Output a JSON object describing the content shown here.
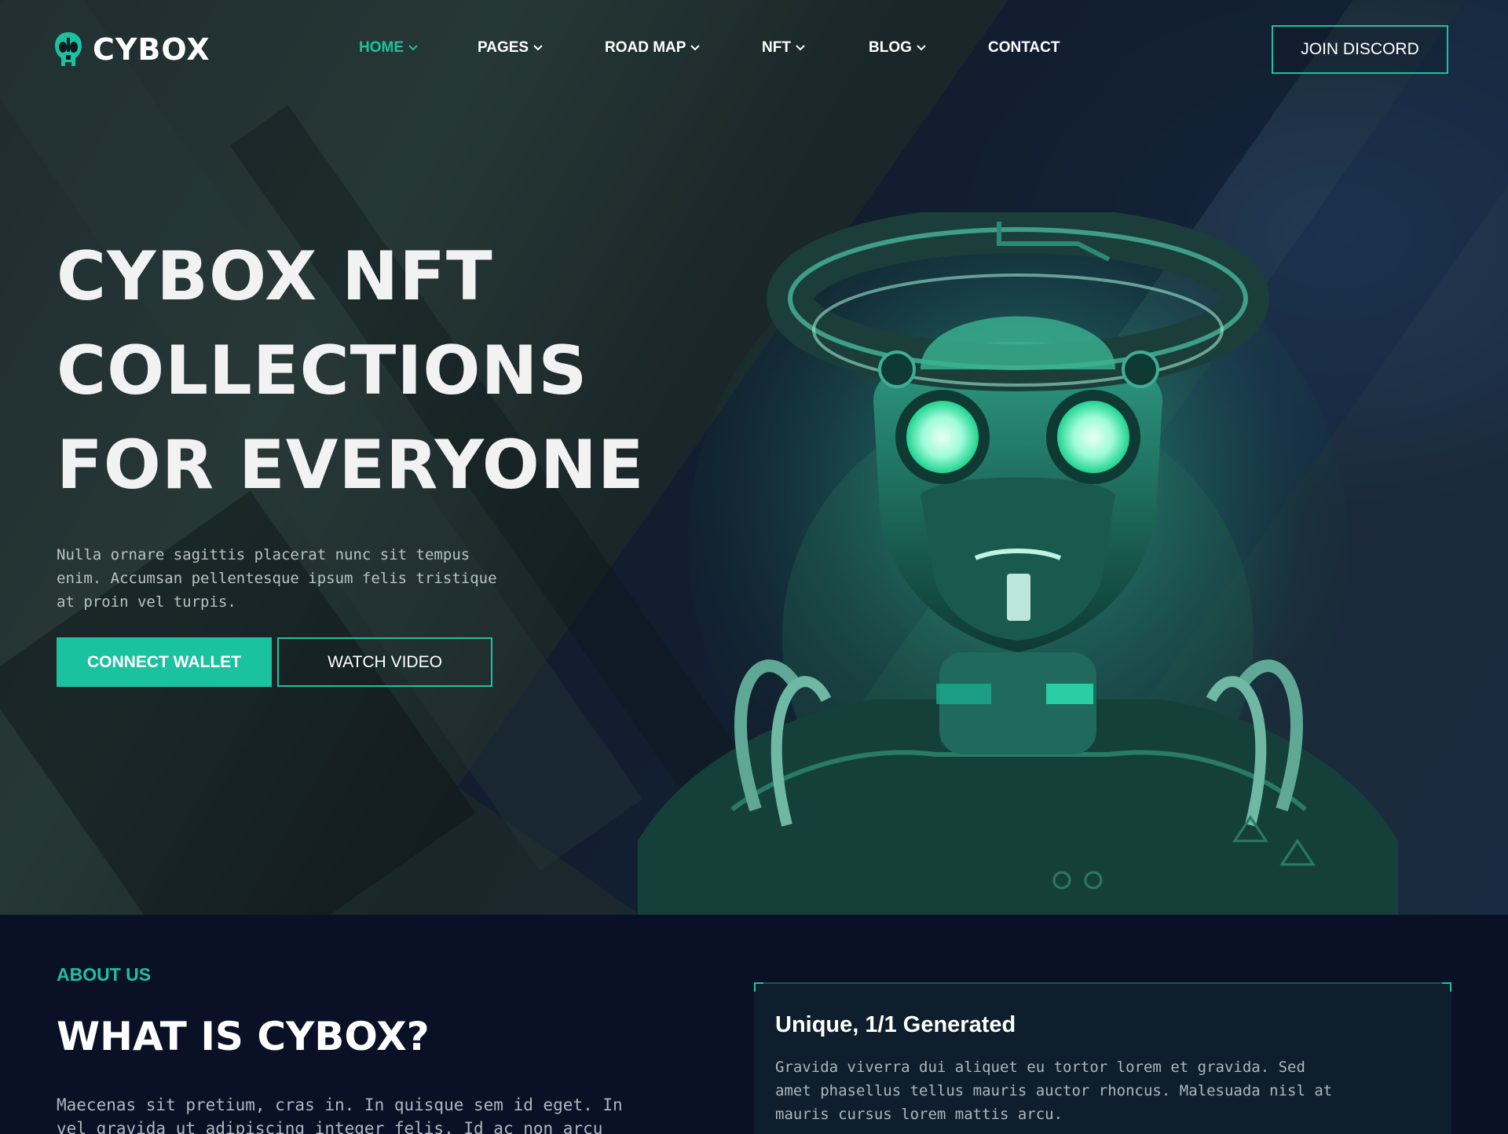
{
  "brand": {
    "name": "CYBOX",
    "accent": "#1bc2a0"
  },
  "nav": {
    "items": [
      {
        "label": "HOME",
        "active": true,
        "has_dropdown": true
      },
      {
        "label": "PAGES",
        "active": false,
        "has_dropdown": true
      },
      {
        "label": "ROAD MAP",
        "active": false,
        "has_dropdown": true
      },
      {
        "label": "NFT",
        "active": false,
        "has_dropdown": true
      },
      {
        "label": "BLOG",
        "active": false,
        "has_dropdown": true
      },
      {
        "label": "CONTACT",
        "active": false,
        "has_dropdown": false
      }
    ],
    "cta": "JOIN DISCORD"
  },
  "hero": {
    "title_lines": [
      "CYBOX NFT",
      "COLLECTIONS",
      "FOR EVERYONE"
    ],
    "desc_lines": [
      "Nulla ornare sagittis placerat nunc sit tempus",
      "enim. Accumsan pellentesque ipsum felis tristique",
      "at proin vel turpis."
    ],
    "primary_button": "CONNECT WALLET",
    "secondary_button": "WATCH VIDEO"
  },
  "about": {
    "eyebrow": "ABOUT US",
    "title": "WHAT IS CYBOX?",
    "desc_lines": [
      "Maecenas sit pretium, cras in. In quisque sem id eget. In",
      "vel gravida ut adipiscing integer felis. Id ac non arcu"
    ],
    "card": {
      "title": "Unique, 1/1 Generated",
      "desc_lines": [
        "Gravida viverra dui aliquet eu tortor lorem et gravida. Sed",
        "amet phasellus tellus mauris auctor rhoncus. Malesuada nisl at",
        "mauris cursus lorem mattis arcu."
      ]
    }
  }
}
